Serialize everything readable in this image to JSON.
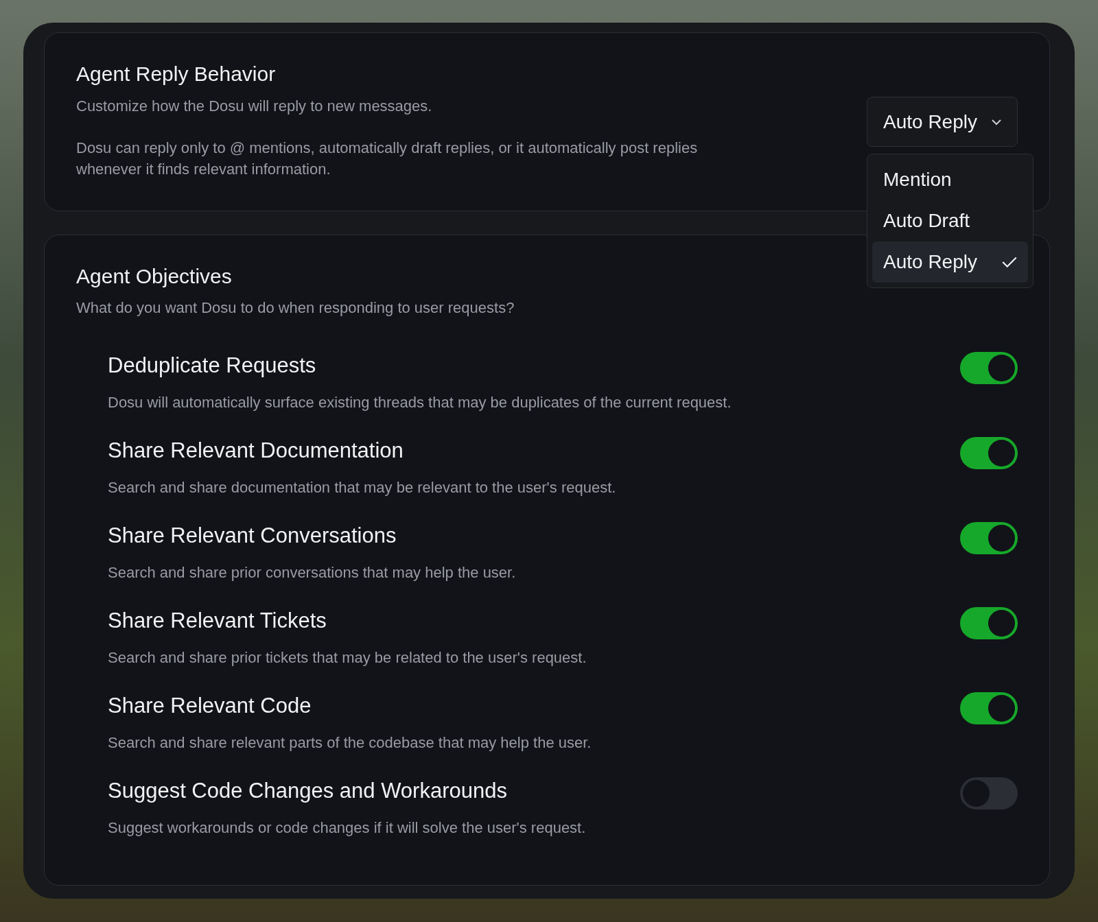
{
  "reply_behavior": {
    "title": "Agent Reply Behavior",
    "subtitle": "Customize how the Dosu will reply to new messages.",
    "description": "Dosu can reply only to @ mentions, automatically draft replies, or it automatically post replies whenever it finds relevant information.",
    "dropdown": {
      "value": "Auto Reply",
      "expanded": true
    },
    "menu": [
      {
        "label": "Mention",
        "selected": false
      },
      {
        "label": "Auto Draft",
        "selected": false
      },
      {
        "label": "Auto Reply",
        "selected": true
      }
    ]
  },
  "objectives": {
    "title": "Agent Objectives",
    "subtitle": "What do you want Dosu to do when responding to user requests?",
    "items": [
      {
        "title": "Deduplicate Requests",
        "description": "Dosu will automatically surface existing threads that may be duplicates of the current request.",
        "on": true
      },
      {
        "title": "Share Relevant Documentation",
        "description": "Search and share documentation that may be relevant to the user's request.",
        "on": true
      },
      {
        "title": "Share Relevant Conversations",
        "description": "Search and share prior conversations that may help the user.",
        "on": true
      },
      {
        "title": "Share Relevant Tickets",
        "description": "Search and share prior tickets that may be related to the user's request.",
        "on": true
      },
      {
        "title": "Share Relevant Code",
        "description": "Search and share relevant parts of the codebase that may help the user.",
        "on": true
      },
      {
        "title": "Suggest Code Changes and Workarounds",
        "description": "Suggest workarounds or code changes if it will solve the user's request.",
        "on": false
      }
    ]
  }
}
